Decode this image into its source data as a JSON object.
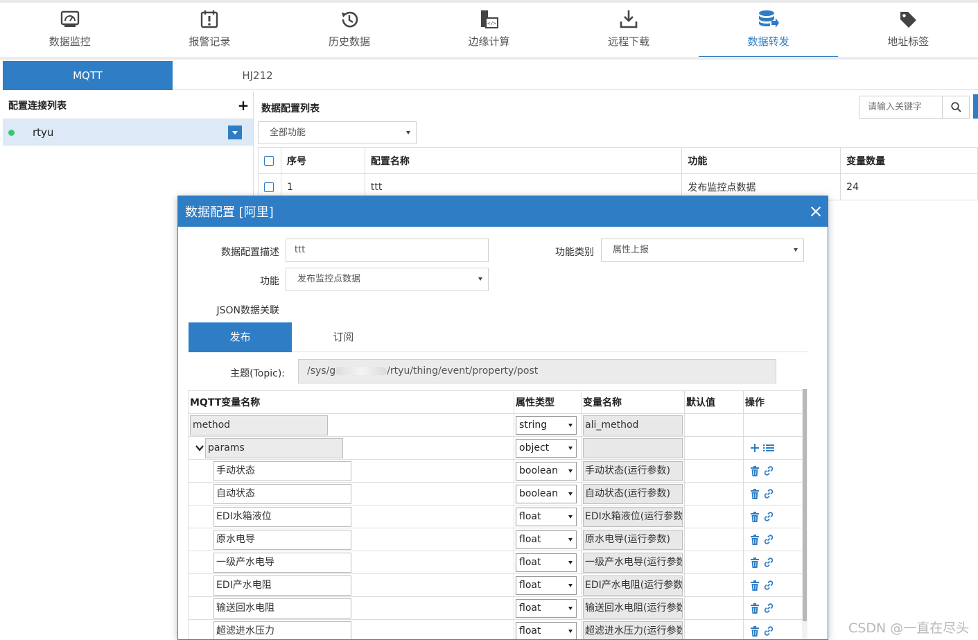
{
  "colors": {
    "accent": "#2f7dc4",
    "status_online": "#2fce6a"
  },
  "nav": [
    {
      "label": "数据监控",
      "icon": "monitor-icon",
      "active": false
    },
    {
      "label": "报警记录",
      "icon": "alarm-icon",
      "active": false
    },
    {
      "label": "历史数据",
      "icon": "history-icon",
      "active": false
    },
    {
      "label": "边缘计算",
      "icon": "edge-compute-icon",
      "active": false
    },
    {
      "label": "远程下载",
      "icon": "download-icon",
      "active": false
    },
    {
      "label": "数据转发",
      "icon": "database-forward-icon",
      "active": true
    },
    {
      "label": "地址标签",
      "icon": "tag-icon",
      "active": false
    }
  ],
  "protocol_tabs": [
    {
      "label": "MQTT",
      "active": true
    },
    {
      "label": "HJ212",
      "active": false
    }
  ],
  "left": {
    "title": "配置连接列表",
    "add_symbol": "+",
    "connection": {
      "name": "rtyu",
      "status": "online"
    }
  },
  "right": {
    "title": "数据配置列表",
    "search_placeholder": "请输入关键字",
    "filter_value": "全部功能",
    "table": {
      "headers": [
        "序号",
        "配置名称",
        "功能",
        "变量数量"
      ],
      "rows": [
        {
          "index": "1",
          "name": "ttt",
          "function": "发布监控点数据",
          "count": "24"
        }
      ]
    }
  },
  "modal": {
    "title": "数据配置 [阿里]",
    "desc_label": "数据配置描述",
    "desc_value": "ttt",
    "category_label": "功能类别",
    "category_value": "属性上报",
    "function_label": "功能",
    "function_value": "发布监控点数据",
    "json_label": "JSON数据关联",
    "tabs": [
      {
        "label": "发布",
        "active": true
      },
      {
        "label": "订阅",
        "active": false
      }
    ],
    "topic_label": "主题(Topic):",
    "topic_prefix": "/sys/g",
    "topic_suffix": "/rtyu/thing/event/property/post",
    "table_headers": [
      "MQTT变量名称",
      "属性类型",
      "变量名称",
      "默认值",
      "操作"
    ],
    "rows": [
      {
        "name": "method",
        "type": "string",
        "var": "ali_method",
        "level": 0,
        "kind": "root"
      },
      {
        "name": "params",
        "type": "object",
        "var": "",
        "level": 0,
        "kind": "group"
      },
      {
        "name": "手动状态",
        "type": "boolean",
        "var": "手动状态(运行参数)",
        "level": 1,
        "kind": "child"
      },
      {
        "name": "自动状态",
        "type": "boolean",
        "var": "自动状态(运行参数)",
        "level": 1,
        "kind": "child"
      },
      {
        "name": "EDI水箱液位",
        "type": "float",
        "var": "EDI水箱液位(运行参数)",
        "level": 1,
        "kind": "child"
      },
      {
        "name": "原水电导",
        "type": "float",
        "var": "原水电导(运行参数)",
        "level": 1,
        "kind": "child"
      },
      {
        "name": "一级产水电导",
        "type": "float",
        "var": "一级产水电导(运行参数)",
        "level": 1,
        "kind": "child"
      },
      {
        "name": "EDI产水电阻",
        "type": "float",
        "var": "EDI产水电阻(运行参数)",
        "level": 1,
        "kind": "child"
      },
      {
        "name": "输送回水电阻",
        "type": "float",
        "var": "输送回水电阻(运行参数)",
        "level": 1,
        "kind": "child"
      },
      {
        "name": "超滤进水压力",
        "type": "float",
        "var": "超滤进水压力(运行参数)",
        "level": 1,
        "kind": "child"
      }
    ]
  },
  "watermark": "CSDN @一直在尽头"
}
